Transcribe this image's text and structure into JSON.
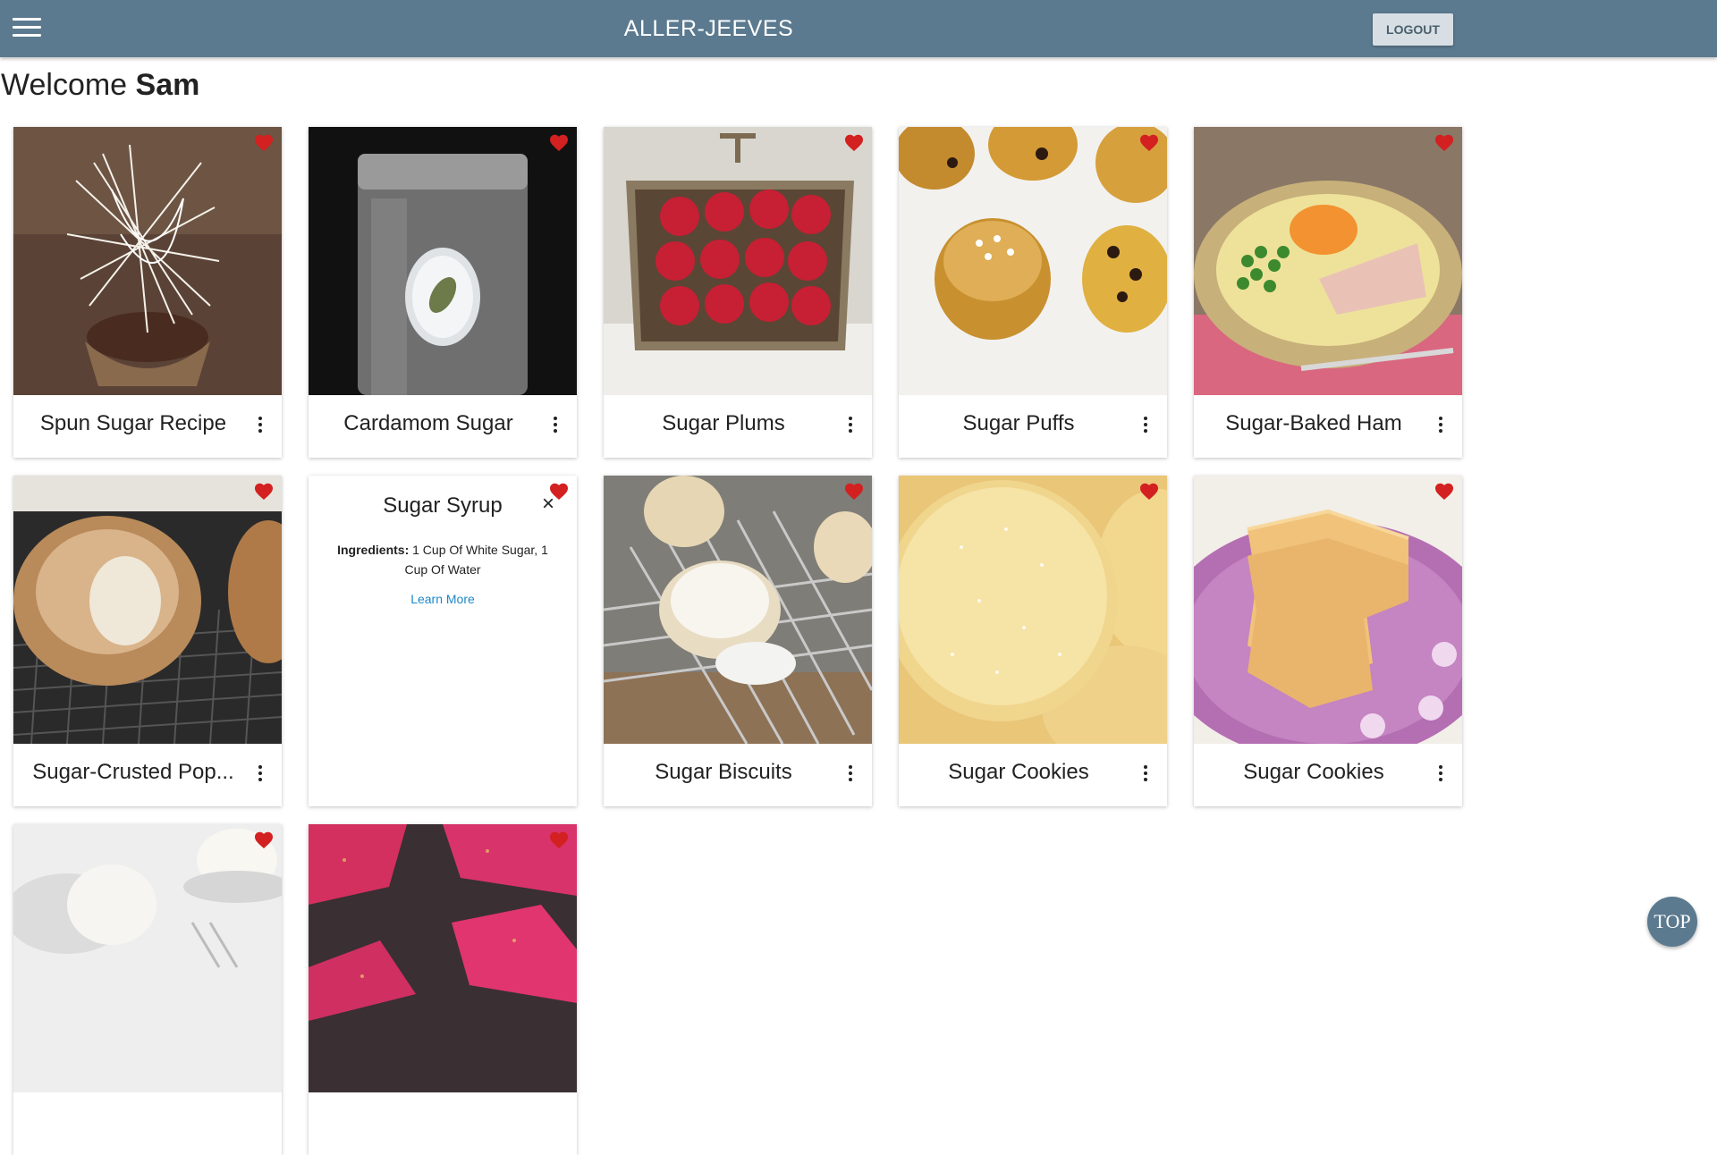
{
  "app": {
    "title": "ALLER-JEEVES",
    "logout_label": "LOGOUT",
    "menu_icon": "hamburger-menu-icon",
    "top_button_label": "TOP"
  },
  "welcome": {
    "greeting": "Welcome",
    "username": "Sam"
  },
  "colors": {
    "header": "#5b7a8f",
    "heart": "#d32020",
    "link": "#1e88c8",
    "logout_bg": "#d7dfe4"
  },
  "recipes": [
    {
      "title": "Spun Sugar Recipe",
      "favorited": true,
      "icon": "heart-icon",
      "menu_icon": "more-vert-icon"
    },
    {
      "title": "Cardamom Sugar",
      "favorited": true,
      "icon": "heart-icon",
      "menu_icon": "more-vert-icon"
    },
    {
      "title": "Sugar Plums",
      "favorited": true,
      "icon": "heart-icon",
      "menu_icon": "more-vert-icon"
    },
    {
      "title": "Sugar Puffs",
      "favorited": true,
      "icon": "heart-icon",
      "menu_icon": "more-vert-icon"
    },
    {
      "title": "Sugar-Baked Ham",
      "favorited": true,
      "icon": "heart-icon",
      "menu_icon": "more-vert-icon"
    },
    {
      "title": "Sugar-Crusted Pop...",
      "favorited": true,
      "icon": "heart-icon",
      "menu_icon": "more-vert-icon"
    },
    {
      "title": "Sugar Syrup",
      "favorited": true,
      "revealed": true,
      "ingredients_label": "Ingredients:",
      "ingredients": "1 Cup Of White Sugar, 1 Cup Of Water",
      "learn_more": "Learn More",
      "close_icon": "close-icon"
    },
    {
      "title": "Sugar Biscuits",
      "favorited": true,
      "icon": "heart-icon",
      "menu_icon": "more-vert-icon"
    },
    {
      "title": "Sugar Cookies",
      "favorited": true,
      "icon": "heart-icon",
      "menu_icon": "more-vert-icon"
    },
    {
      "title": "Sugar Cookies",
      "favorited": true,
      "icon": "heart-icon",
      "menu_icon": "more-vert-icon"
    },
    {
      "title": "",
      "favorited": true,
      "icon": "heart-icon"
    },
    {
      "title": "",
      "favorited": true,
      "icon": "heart-icon"
    }
  ]
}
